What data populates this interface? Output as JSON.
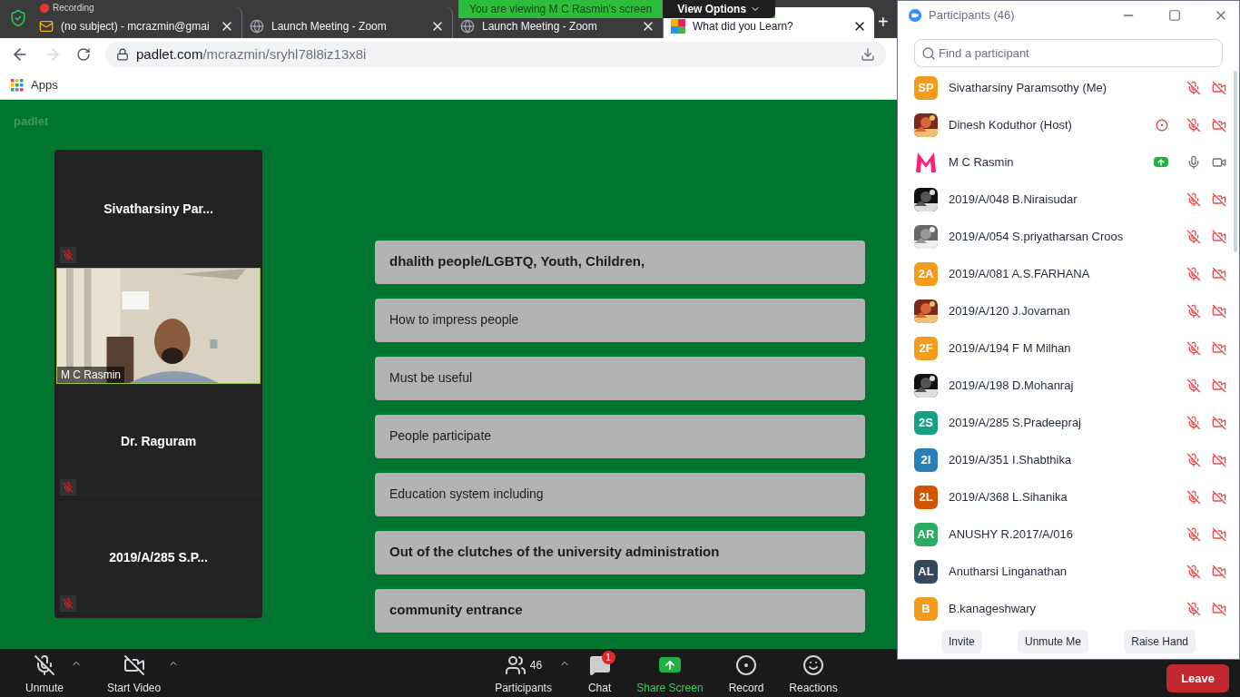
{
  "browser": {
    "recording_label": "Recording",
    "tabs": [
      {
        "title": "(no subject) - mcrazmin@gmai",
        "kind": "mail",
        "selected": false
      },
      {
        "title": "Launch Meeting - Zoom",
        "kind": "globe",
        "selected": false
      },
      {
        "title": "Launch Meeting - Zoom",
        "kind": "globe",
        "selected": false
      },
      {
        "title": "What did you Learn?",
        "kind": "padlet",
        "selected": true
      }
    ],
    "new_tab": "+",
    "url_host": "padlet.com",
    "url_path": "/mcrazmin/sryhl78l8iz13x8i",
    "bookmarks": [
      "Apps"
    ]
  },
  "share_banner": {
    "text": "You are viewing M C Rasmin's screen",
    "view_options": "View Options"
  },
  "padlet": {
    "logo": "padlet",
    "posts": [
      {
        "text": "dhalith people/LGBTQ, Youth, Children,",
        "bold": true
      },
      {
        "text": "How to impress people",
        "bold": false
      },
      {
        "text": "Must be useful",
        "bold": false
      },
      {
        "text": "People participate",
        "bold": false
      },
      {
        "text": "Education system including",
        "bold": false
      },
      {
        "text": "Out of the clutches of the university administration",
        "bold": true
      },
      {
        "text": "community entrance",
        "bold": true
      }
    ]
  },
  "video_tiles": [
    {
      "name": "Sivatharsiny  Par...",
      "kind": "name",
      "muted": true
    },
    {
      "name": "M C Rasmin",
      "kind": "video",
      "muted": false
    },
    {
      "name": "Dr. Raguram",
      "kind": "name",
      "muted": true
    },
    {
      "name": "2019/A/285 S.P...",
      "kind": "name",
      "muted": true
    }
  ],
  "participants_panel": {
    "title": "Participants (46)",
    "search": {
      "placeholder": "Find a participant"
    },
    "participants": [
      {
        "name": "Sivatharsiny Paramsothy (Me)",
        "avatar": {
          "kind": "initials",
          "text": "SP",
          "color": "#f29b1c"
        },
        "recording": false,
        "sharing": false,
        "muted": true,
        "video_off": true
      },
      {
        "name": "Dinesh Koduthor (Host)",
        "recording": true,
        "sharing": false,
        "muted": true,
        "video_off": true
      },
      {
        "name": "M C Rasmin",
        "avatar": {
          "kind": "logo"
        },
        "recording": false,
        "sharing": true,
        "muted": false,
        "video_off": false
      },
      {
        "name": "2019/A/048 B.Niraisudar",
        "recording": false,
        "sharing": false,
        "muted": true,
        "video_off": true
      },
      {
        "name": "2019/A/054 S.priyatharsan Croos",
        "recording": false,
        "sharing": false,
        "muted": true,
        "video_off": true
      },
      {
        "name": "2019/A/081 A.S.FARHANA",
        "avatar": {
          "kind": "initials",
          "text": "2A",
          "color": "#f29b1c"
        },
        "recording": false,
        "sharing": false,
        "muted": true,
        "video_off": true
      },
      {
        "name": "2019/A/120 J.Jovarnan",
        "recording": false,
        "sharing": false,
        "muted": true,
        "video_off": true
      },
      {
        "name": "2019/A/194 F M Milhan",
        "avatar": {
          "kind": "initials",
          "text": "2F",
          "color": "#f29b1c"
        },
        "recording": false,
        "sharing": false,
        "muted": true,
        "video_off": true
      },
      {
        "name": "2019/A/198 D.Mohanraj",
        "recording": false,
        "sharing": false,
        "muted": true,
        "video_off": true
      },
      {
        "name": "2019/A/285 S.Pradeepraj",
        "avatar": {
          "kind": "initials",
          "text": "2S",
          "color": "#16a085"
        },
        "recording": false,
        "sharing": false,
        "muted": true,
        "video_off": true
      },
      {
        "name": "2019/A/351 I.Shabthika",
        "avatar": {
          "kind": "initials",
          "text": "2I",
          "color": "#2980b9"
        },
        "recording": false,
        "sharing": false,
        "muted": true,
        "video_off": true
      },
      {
        "name": "2019/A/368 L.Sihanika",
        "avatar": {
          "kind": "initials",
          "text": "2L",
          "color": "#d35400"
        },
        "recording": false,
        "sharing": false,
        "muted": true,
        "video_off": true
      },
      {
        "name": "ANUSHY R.2017/A/016",
        "avatar": {
          "kind": "initials",
          "text": "AR",
          "color": "#27ae60"
        },
        "recording": false,
        "sharing": false,
        "muted": true,
        "video_off": true
      },
      {
        "name": "Anutharsi Linganathan",
        "avatar": {
          "kind": "initials",
          "text": "AL",
          "color": "#34495e"
        },
        "recording": false,
        "sharing": false,
        "muted": true,
        "video_off": true
      },
      {
        "name": "B.kanageshwary",
        "avatar": {
          "kind": "initials",
          "text": "B",
          "color": "#f29b1c"
        },
        "recording": false,
        "sharing": false,
        "muted": true,
        "video_off": true
      }
    ],
    "buttons": [
      "Invite",
      "Unmute Me",
      "Raise Hand"
    ]
  },
  "toolbar": {
    "items": [
      {
        "label": "Unmute",
        "kind": "mic",
        "off": true,
        "caret": true
      },
      {
        "label": "Start Video",
        "kind": "video",
        "off": true,
        "caret": true
      },
      {
        "label": "Participants",
        "kind": "participants",
        "count": "46",
        "caret": true
      },
      {
        "label": "Chat",
        "kind": "chat",
        "badge": "1"
      },
      {
        "label": "Share Screen",
        "kind": "share"
      },
      {
        "label": "Record",
        "kind": "record"
      },
      {
        "label": "Reactions",
        "kind": "reactions"
      }
    ],
    "leave": "Leave"
  }
}
